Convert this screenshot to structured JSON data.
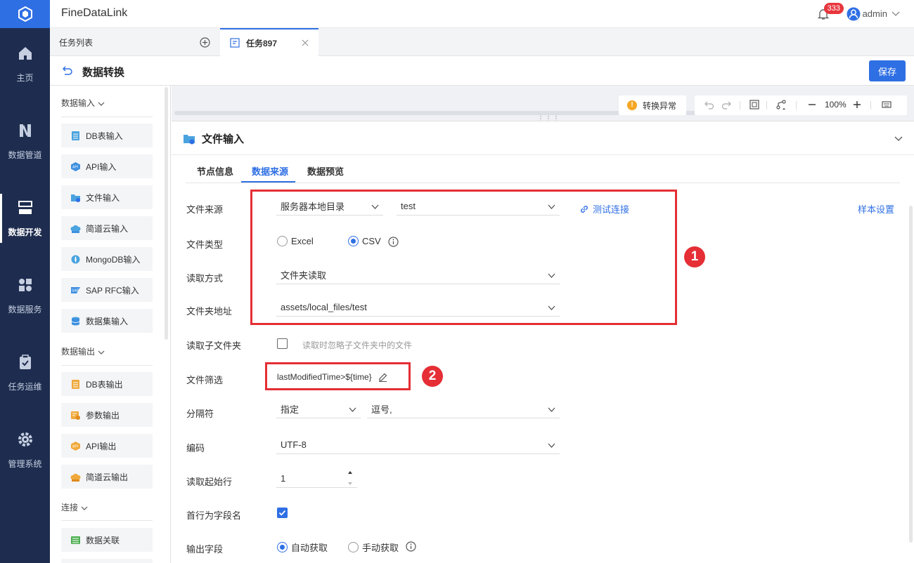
{
  "header": {
    "app_title": "FineDataLink",
    "notif_count": "333",
    "user": "admin"
  },
  "nav": {
    "items": [
      {
        "label": "主页"
      },
      {
        "label": "数据管道"
      },
      {
        "label": "数据开发"
      },
      {
        "label": "数据服务"
      },
      {
        "label": "任务运维"
      },
      {
        "label": "管理系统"
      }
    ]
  },
  "tabs": {
    "list_label": "任务列表",
    "active_label": "任务897"
  },
  "page": {
    "title": "数据转换",
    "save_label": "保存"
  },
  "components": {
    "input_group": "数据输入",
    "inputs": [
      "DB表输入",
      "API输入",
      "文件输入",
      "简道云输入",
      "MongoDB输入",
      "SAP RFC输入",
      "数据集输入"
    ],
    "output_group": "数据输出",
    "outputs": [
      "DB表输出",
      "参数输出",
      "API输出",
      "简道云输出"
    ],
    "connect_group": "连接",
    "connects": [
      "数据关联"
    ]
  },
  "canvas": {
    "warn_label": "转换异常",
    "zoom": "100%"
  },
  "config": {
    "title": "文件输入",
    "tabs": [
      "节点信息",
      "数据来源",
      "数据预览"
    ],
    "sample_settings": "样本设置",
    "file_source": {
      "label": "文件来源",
      "type": "服务器本地目录",
      "value": "test",
      "test_link": "测试连接"
    },
    "file_type": {
      "label": "文件类型",
      "opt1": "Excel",
      "opt2": "CSV",
      "selected": "CSV"
    },
    "read_mode": {
      "label": "读取方式",
      "value": "文件夹读取"
    },
    "folder": {
      "label": "文件夹地址",
      "value": "assets/local_files/test"
    },
    "subfolder": {
      "label": "读取子文件夹",
      "hint": "读取时忽略子文件夹中的文件"
    },
    "filter": {
      "label": "文件筛选",
      "value": "lastModifiedTime>${time}"
    },
    "delimiter": {
      "label": "分隔符",
      "mode": "指定",
      "value": "逗号,"
    },
    "encoding": {
      "label": "编码",
      "value": "UTF-8"
    },
    "start_row": {
      "label": "读取起始行",
      "value": "1"
    },
    "header_row": {
      "label": "首行为字段名"
    },
    "output_fields": {
      "label": "输出字段",
      "opt1": "自动获取",
      "opt2": "手动获取"
    },
    "annotations": [
      "1",
      "2"
    ]
  },
  "colors": {
    "nav_bg": "#1e2d4f",
    "accent": "#2f6fe4",
    "highlight": "#e52e35"
  }
}
